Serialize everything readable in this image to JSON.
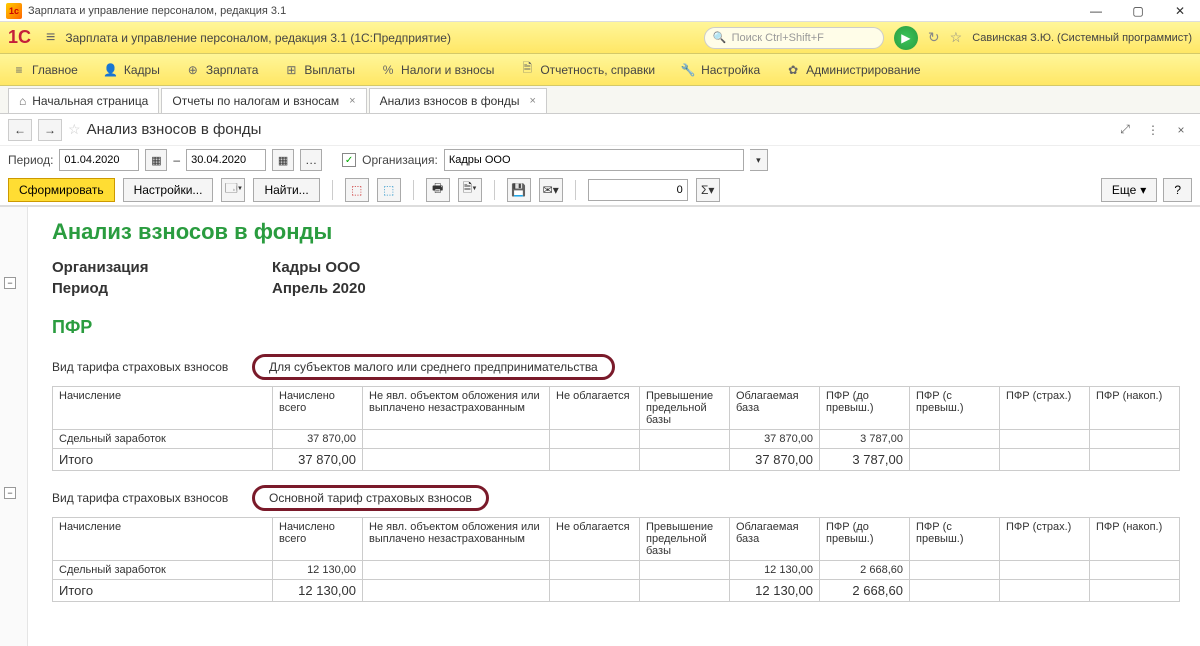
{
  "window": {
    "title": "Зарплата и управление персоналом, редакция 3.1",
    "minimize": "—",
    "maximize": "▢",
    "close": "✕"
  },
  "header": {
    "logo": "1C",
    "apptitle": "Зарплата и управление персоналом, редакция 3.1  (1С:Предприятие)",
    "search_placeholder": "Поиск Ctrl+Shift+F",
    "user": "Савинская З.Ю. (Системный программист)"
  },
  "mainmenu": [
    {
      "icon": "≡",
      "label": "Главное"
    },
    {
      "icon": "👤",
      "label": "Кадры"
    },
    {
      "icon": "💰",
      "label": "Зарплата"
    },
    {
      "icon": "%",
      "label": "Выплаты"
    },
    {
      "icon": "%",
      "label": "Налоги и взносы"
    },
    {
      "icon": "📄",
      "label": "Отчетность, справки"
    },
    {
      "icon": "🔧",
      "label": "Настройка"
    },
    {
      "icon": "⚙",
      "label": "Администрирование"
    }
  ],
  "tabs": [
    {
      "label": "Начальная страница",
      "home": true
    },
    {
      "label": "Отчеты по налогам и взносам",
      "closable": true
    },
    {
      "label": "Анализ взносов в фонды",
      "closable": true
    }
  ],
  "page": {
    "title": "Анализ взносов в фонды"
  },
  "filters": {
    "period_label": "Период:",
    "date_from": "01.04.2020",
    "dash": "–",
    "date_to": "30.04.2020",
    "org_label": "Организация:",
    "org_value": "Кадры ООО"
  },
  "actions": {
    "form": "Сформировать",
    "settings": "Настройки...",
    "find": "Найти...",
    "numvalue": "0",
    "more": "Еще",
    "help": "?"
  },
  "report": {
    "title": "Анализ взносов в фонды",
    "org_label": "Организация",
    "org_value": "Кадры ООО",
    "period_label": "Период",
    "period_value": "Апрель 2020",
    "section": "ПФР",
    "tariff_label": "Вид тарифа страховых взносов",
    "headers": {
      "c1": "Начисление",
      "c2": "Начислено всего",
      "c3": "Не явл. объектом обложения или выплачено незастрахованным",
      "c4": "Не облагается",
      "c5": "Превышение предельной базы",
      "c6": "Облагаемая база",
      "c7": "ПФР (до превыш.)",
      "c8": "ПФР (с превыш.)",
      "c9": "ПФР (страх.)",
      "c10": "ПФР (накоп.)"
    },
    "groups": [
      {
        "tariff": "Для субъектов малого или среднего предпринимательства",
        "row_name": "Сдельный заработок",
        "row_total": "37 870,00",
        "row_base": "37 870,00",
        "row_pfr": "3 787,00",
        "total_label": "Итого",
        "total_total": "37 870,00",
        "total_base": "37 870,00",
        "total_pfr": "3 787,00"
      },
      {
        "tariff": "Основной тариф страховых взносов",
        "row_name": "Сдельный заработок",
        "row_total": "12 130,00",
        "row_base": "12 130,00",
        "row_pfr": "2 668,60",
        "total_label": "Итого",
        "total_total": "12 130,00",
        "total_base": "12 130,00",
        "total_pfr": "2 668,60"
      }
    ]
  }
}
